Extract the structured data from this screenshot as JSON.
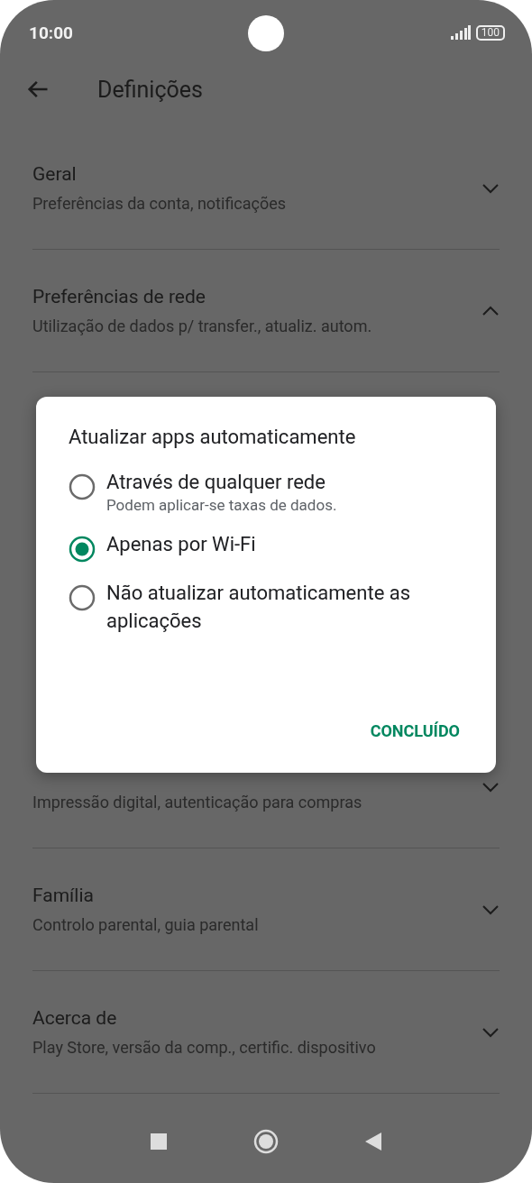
{
  "status_bar": {
    "time": "10:00",
    "battery": "100"
  },
  "header": {
    "title": "Definições"
  },
  "settings": [
    {
      "title": "Geral",
      "subtitle": "Preferências da conta, notificações",
      "expanded": false
    },
    {
      "title": "Preferências de rede",
      "subtitle": "Utilização de dados p/ transfer., atualiz. autom.",
      "expanded": true
    },
    {
      "kind": "hidden"
    },
    {
      "subtitle": "Impressão digital, autenticação para compras",
      "expanded": false
    },
    {
      "title": "Família",
      "subtitle": "Controlo parental, guia parental",
      "expanded": false
    },
    {
      "title": "Acerca de",
      "subtitle": "Play Store, versão da comp., certific. dispositivo",
      "expanded": false
    }
  ],
  "dialog": {
    "title": "Atualizar apps automaticamente",
    "options": [
      {
        "label": "Através de qualquer rede",
        "hint": "Podem aplicar-se taxas de dados.",
        "selected": false
      },
      {
        "label": "Apenas por Wi-Fi",
        "selected": true
      },
      {
        "label": "Não atualizar automaticamente as aplicações",
        "selected": false
      }
    ],
    "button": "CONCLUÍDO"
  }
}
